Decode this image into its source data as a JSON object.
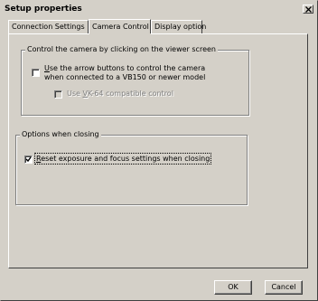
{
  "window": {
    "title": "Setup properties",
    "close_glyph": "×"
  },
  "tabs": [
    {
      "label": "Connection Settings",
      "active": false
    },
    {
      "label": "Camera Control",
      "active": true
    },
    {
      "label": "Display option",
      "active": false
    }
  ],
  "camera_group": {
    "title": "Control the camera by clicking on the viewer screen",
    "arrow_checkbox": {
      "line1_mnemonic": "U",
      "line1_rest": "se the arrow buttons to control the camera",
      "line2": "when connected to a VB150 or newer model",
      "checked": false
    },
    "vk64_checkbox": {
      "prefix": "Use ",
      "mnemonic": "V",
      "rest": "K-64 compatible control",
      "checked": false,
      "disabled": true
    }
  },
  "closing_group": {
    "title": "Options when closing",
    "reset_checkbox": {
      "mnemonic": "R",
      "rest": "eset exposure and focus settings when closing",
      "checked": true
    }
  },
  "buttons": {
    "ok": "OK",
    "cancel": "Cancel"
  },
  "colors": {
    "face": "#d4d0c8",
    "shadow": "#808080",
    "dark_shadow": "#404040",
    "highlight": "#ffffff",
    "disabled_text": "#808080"
  }
}
